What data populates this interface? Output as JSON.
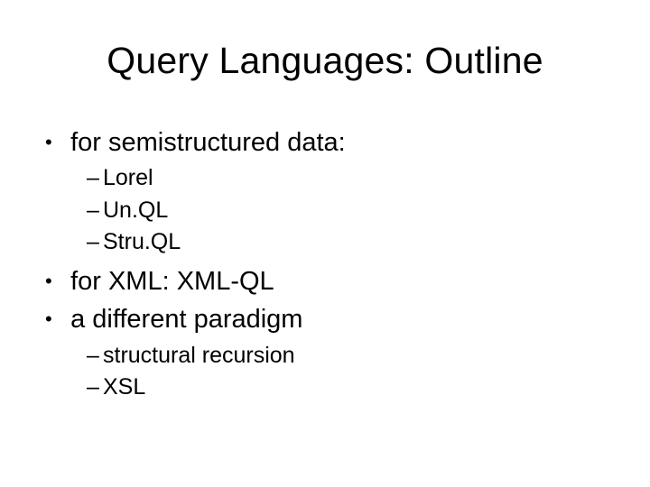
{
  "title": "Query Languages: Outline",
  "bullets": {
    "b1": "for semistructured data:",
    "b1_sub": {
      "s1": "Lorel",
      "s2": "Un.QL",
      "s3": "Stru.QL"
    },
    "b2": "for XML: XML-QL",
    "b3": "a different paradigm",
    "b3_sub": {
      "s1": "structural recursion",
      "s2": "XSL"
    }
  }
}
